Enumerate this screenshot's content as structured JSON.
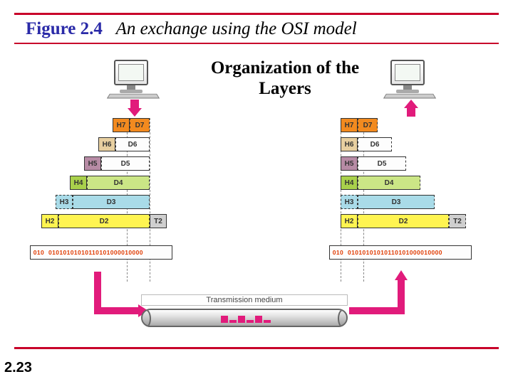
{
  "figure": {
    "number": "Figure 2.4",
    "title": "An exchange using the OSI model"
  },
  "subtitle": "Organization of the Layers",
  "page": "2.23",
  "layers": {
    "l7": {
      "h": "H7",
      "d": "D7"
    },
    "l6": {
      "h": "H6",
      "d": "D6"
    },
    "l5": {
      "h": "H5",
      "d": "D5"
    },
    "l4": {
      "h": "H4",
      "d": "D4"
    },
    "l3": {
      "h": "H3",
      "d": "D3"
    },
    "l2": {
      "h": "H2",
      "d": "D2",
      "t": "T2"
    },
    "l1": {
      "h": "010",
      "d": "01010101010110101000010000"
    },
    "l1r": {
      "d": "01010101010110101000010000"
    }
  },
  "medium": {
    "label": "Transmission medium"
  },
  "colors": {
    "accent": "#c8002a",
    "arrow": "#e11b7b"
  }
}
